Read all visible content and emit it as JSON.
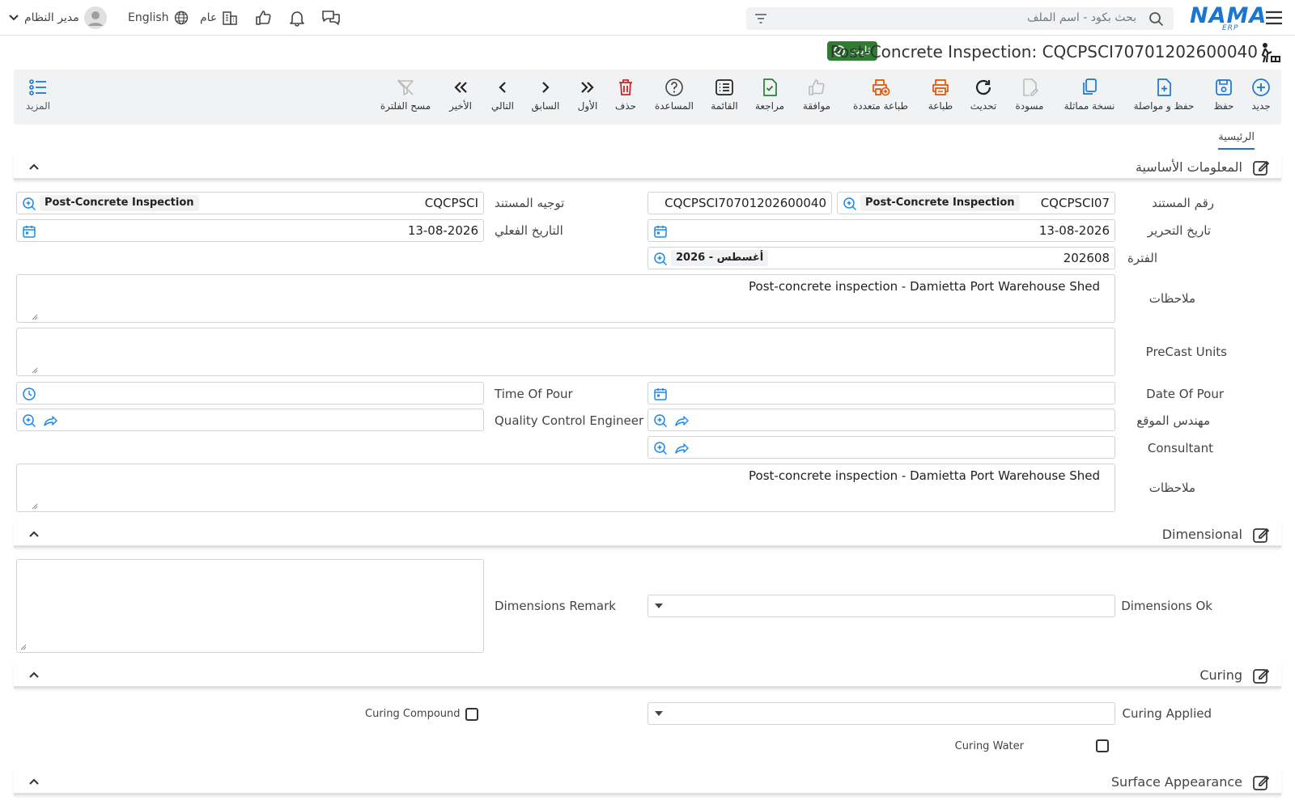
{
  "topbar": {
    "user": "مدير النظام",
    "language": "English",
    "company": "عام",
    "search_placeholder": "بحث بكود - اسم الملف",
    "logo": "NAMA",
    "logo_sub": "ERP"
  },
  "title": {
    "doc_title": "Post-Concrete Inspection: CQCPSCI70701202600040",
    "status": "ثابت"
  },
  "toolbar": {
    "more": "المزيد",
    "clear_filter": "مسح الفلترة",
    "last": "الأخير",
    "next": "التالي",
    "previous": "السابق",
    "first": "الأول",
    "delete": "حذف",
    "help": "المساعدة",
    "list": "القائمة",
    "review": "مراجعة",
    "approve": "موافقة",
    "multi_print": "طباعة متعددة",
    "print": "طباعة",
    "refresh": "تحديث",
    "draft": "مسودة",
    "duplicate": "نسخة مماثلة",
    "save_continue": "حفظ و مواصلة",
    "save": "حفظ",
    "new": "جديد"
  },
  "tabs": {
    "main": "الرئيسية"
  },
  "sections": {
    "basic": "المعلومات الأساسية",
    "dimensional": "Dimensional",
    "curing": "Curing",
    "surface": "Surface Appearance"
  },
  "form": {
    "doc_number_label": "رقم المستند",
    "doc_book_code": "CQCPSCI07",
    "doc_book_name": "Post-Concrete Inspection",
    "doc_number": "CQCPSCI70701202600040",
    "doc_direction_label": "توجيه المستند",
    "doc_direction_code": "CQCPSCI",
    "doc_direction_name": "Post-Concrete Inspection",
    "edit_date_label": "تاريخ التحرير",
    "edit_date": "13-08-2026",
    "actual_date_label": "التاريخ الفعلي",
    "actual_date": "13-08-2026",
    "period_label": "الفترة",
    "period_code": "202608",
    "period_name": "2026 - أغسطس",
    "remarks_label": "ملاحظات",
    "remarks": "Post-concrete inspection - Damietta Port Warehouse Shed",
    "precast_label": "PreCast Units",
    "precast": "",
    "date_of_pour_label": "Date Of Pour",
    "time_of_pour_label": "Time Of Pour",
    "site_engineer_label": "مهندس الموقع",
    "qc_engineer_label": "Quality Control Engineer",
    "consultant_label": "Consultant",
    "remarks2_label": "ملاحظات",
    "remarks2": "Post-concrete inspection - Damietta Port Warehouse Shed",
    "dimensions_ok_label": "Dimensions Ok",
    "dimensions_remark_label": "Dimensions Remark",
    "curing_applied_label": "Curing Applied",
    "curing_compound_label": "Curing Compound",
    "curing_water_label": "Curing Water"
  },
  "colors": {
    "accent": "#1976d2",
    "status_green": "#2e7d32",
    "print_orange": "#e65100",
    "delete_red": "#c62828",
    "review_green": "#2e7d32"
  }
}
